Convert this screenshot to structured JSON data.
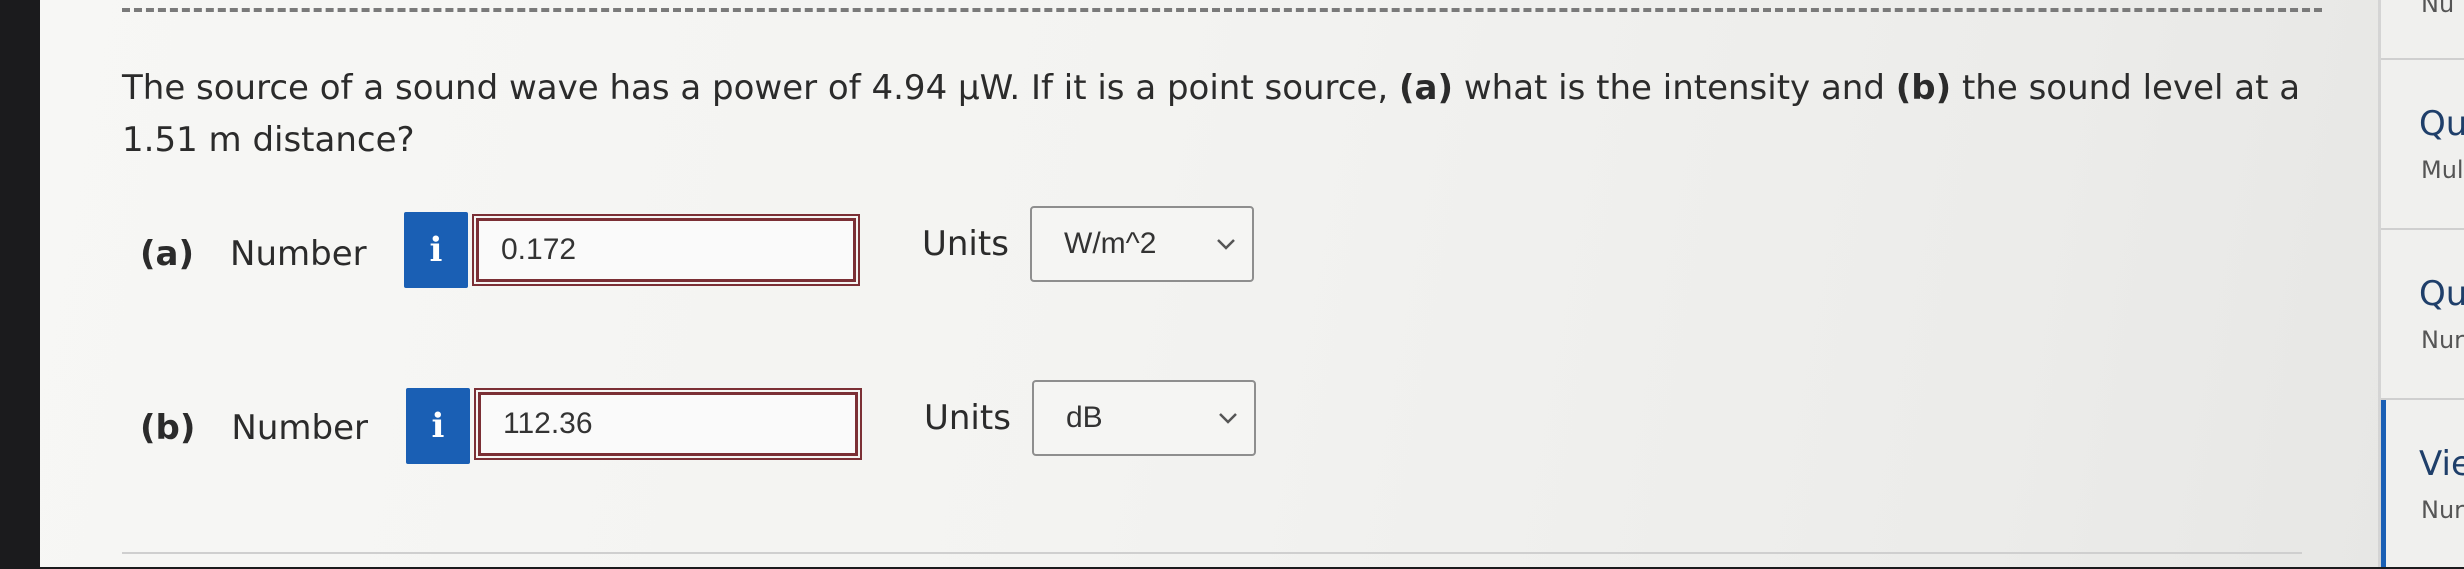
{
  "question": {
    "text_before": "The source of a sound wave has a power of 4.94 μW. If it is a point source, ",
    "part_a_marker": "(a)",
    "text_middle": " what is the intensity and ",
    "part_b_marker": "(b)",
    "text_after": " the sound level at a 1.51 m distance?"
  },
  "parts": [
    {
      "marker": "(a)",
      "label": "Number",
      "info_icon": "i",
      "value": "0.172",
      "units_label": "Units",
      "units_selected": "W/m^2"
    },
    {
      "marker": "(b)",
      "label": "Number",
      "info_icon": "i",
      "value": "112.36",
      "units_label": "Units",
      "units_selected": "dB"
    }
  ],
  "sidebar": {
    "top_partial": "Nu",
    "items": [
      {
        "title": "Qu",
        "subtitle": "Mul"
      },
      {
        "title": "Qu",
        "subtitle": "Nur"
      },
      {
        "title": "Vie",
        "subtitle": "Nur"
      }
    ]
  },
  "colors": {
    "info_button": "#1a5fb4",
    "input_border": "#7b2f35",
    "sidebar_title": "#1f3f6a"
  }
}
